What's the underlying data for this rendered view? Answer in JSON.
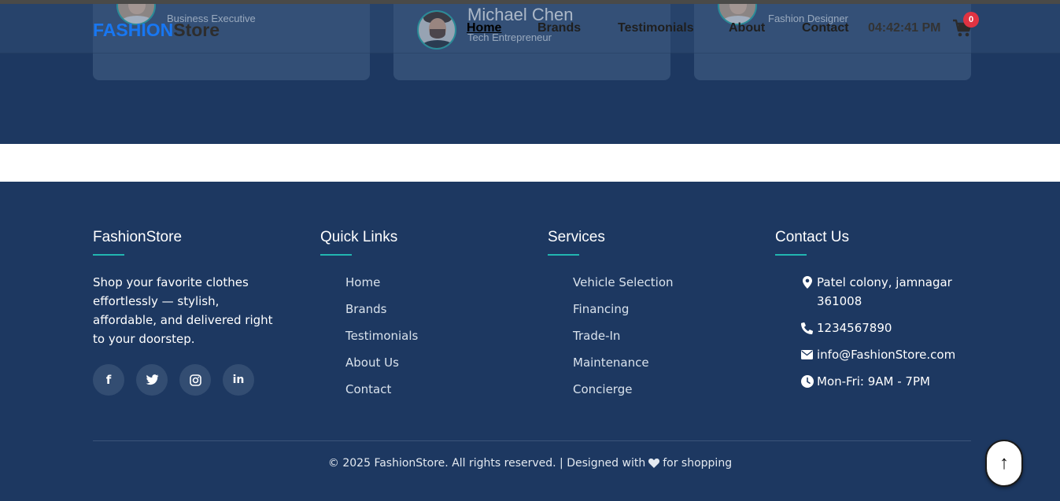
{
  "navbar": {
    "logo_part1": "FASHION",
    "logo_part2": "Store",
    "links": [
      {
        "label": "Home"
      },
      {
        "label": "Brands"
      },
      {
        "label": "Testimonials"
      },
      {
        "label": "About"
      },
      {
        "label": "Contact"
      }
    ],
    "clock": "04:42:41 PM",
    "cart_count": "0"
  },
  "testimonials": [
    {
      "name": "",
      "role": "Business Executive"
    },
    {
      "name": "Michael Chen",
      "role": "Tech Entrepreneur"
    },
    {
      "name": "",
      "role": "Fashion Designer"
    }
  ],
  "footer": {
    "about": {
      "title": "FashionStore",
      "description": "Shop your favorite clothes effortlessly — stylish, affordable, and delivered right to your doorstep.",
      "socials": [
        "facebook-icon",
        "twitter-icon",
        "instagram-icon",
        "linkedin-icon"
      ]
    },
    "quick_links": {
      "title": "Quick Links",
      "items": [
        "Home",
        "Brands",
        "Testimonials",
        "About Us",
        "Contact"
      ]
    },
    "services": {
      "title": "Services",
      "items": [
        "Vehicle Selection",
        "Financing",
        "Trade-In",
        "Maintenance",
        "Concierge"
      ]
    },
    "contact": {
      "title": "Contact Us",
      "address": "Patel colony, jamnagar 361008",
      "phone": "1234567890",
      "email": "info@FashionStore.com",
      "hours": "Mon-Fri: 9AM - 7PM"
    },
    "copyright_before": "© 2025 FashionStore. All rights reserved. | Designed with",
    "copyright_after": "for shopping"
  },
  "scroll_top": {
    "glyph": "↑"
  },
  "colors": {
    "background": "#1d3861",
    "accent": "#22b6b0",
    "logo_blue": "#1877f2",
    "badge_red": "#e03342"
  }
}
